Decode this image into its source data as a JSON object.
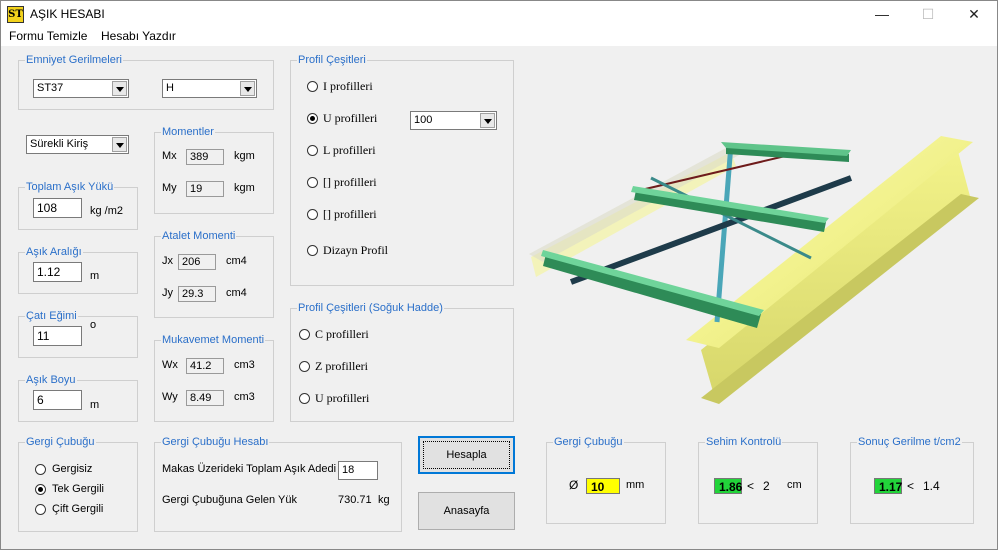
{
  "window": {
    "title": "AŞIK HESABI",
    "icon_text": "ST",
    "minimize": "—",
    "maximize": "☐",
    "close": "✕"
  },
  "menu": [
    "Formu Temizle",
    "Hesabı Yazdır"
  ],
  "emniyet": {
    "legend": "Emniyet Gerilmeleri",
    "steel": "ST37",
    "load": "H"
  },
  "beam_type": "Sürekli Kiriş",
  "toplam": {
    "legend": "Toplam Aşık Yükü",
    "value": "108",
    "unit": "kg /m2"
  },
  "aralik": {
    "legend": "Aşık Aralığı",
    "value": "1.12",
    "unit": "m"
  },
  "egim": {
    "legend": "Çatı Eğimi",
    "value": "11",
    "unit": "o"
  },
  "boy": {
    "legend": "Aşık Boyu",
    "value": "6",
    "unit": "m"
  },
  "momentler": {
    "legend": "Momentler",
    "mx_label": "Mx",
    "mx": "389",
    "my_label": "My",
    "my": "19",
    "unit": "kgm"
  },
  "atalet": {
    "legend": "Atalet Momenti",
    "jx_label": "Jx",
    "jx": "206",
    "jy_label": "Jy",
    "jy": "29.3",
    "unit": "cm4"
  },
  "mukavemet": {
    "legend": "Mukavemet Momenti",
    "wx_label": "Wx",
    "wx": "41.2",
    "wy_label": "Wy",
    "wy": "8.49",
    "unit": "cm3"
  },
  "profil": {
    "legend": "Profil Çeşitleri",
    "options": [
      "I profilleri",
      "U profilleri",
      "L profilleri",
      "[] profilleri",
      "[] profilleri",
      "Dizayn Profil"
    ],
    "selected_index": 1,
    "size": "100"
  },
  "soguk": {
    "legend": "Profil Çeşitleri (Soğuk Hadde)",
    "options": [
      "C profilleri",
      "Z profilleri",
      "U profilleri"
    ]
  },
  "gergi": {
    "legend": "Gergi Çubuğu",
    "options": [
      "Gergisiz",
      "Tek Gergili",
      "Çift Gergili"
    ],
    "selected_index": 1
  },
  "gergi_hesap": {
    "legend": "Gergi Çubuğu Hesabı",
    "makas_label": "Makas Üzerideki Toplam Aşık Adedi",
    "makas_value": "18",
    "yuk_label": "Gergi Çubuğuna Gelen Yük",
    "yuk_value": "730.71",
    "yuk_unit": "kg"
  },
  "buttons": {
    "hesapla": "Hesapla",
    "anasayfa": "Anasayfa"
  },
  "result_gergi": {
    "legend": "Gergi Çubuğu",
    "symbol": "Ø",
    "value": "10",
    "unit": "mm"
  },
  "result_sehim": {
    "legend": "Sehim Kontrolü",
    "value": "1.86",
    "lt": "<",
    "limit": "2",
    "unit": "cm"
  },
  "result_gerilme": {
    "legend": "Sonuç Gerilme t/cm2",
    "value": "1.17",
    "lt": "<",
    "limit": "1.4"
  },
  "colors": {
    "legend": "#2a6fc9",
    "result_green": "#22d43a",
    "result_yellow": "#ffff00",
    "beam_yellow": "#e8e87a",
    "purlin_green": "#2e8b57"
  }
}
